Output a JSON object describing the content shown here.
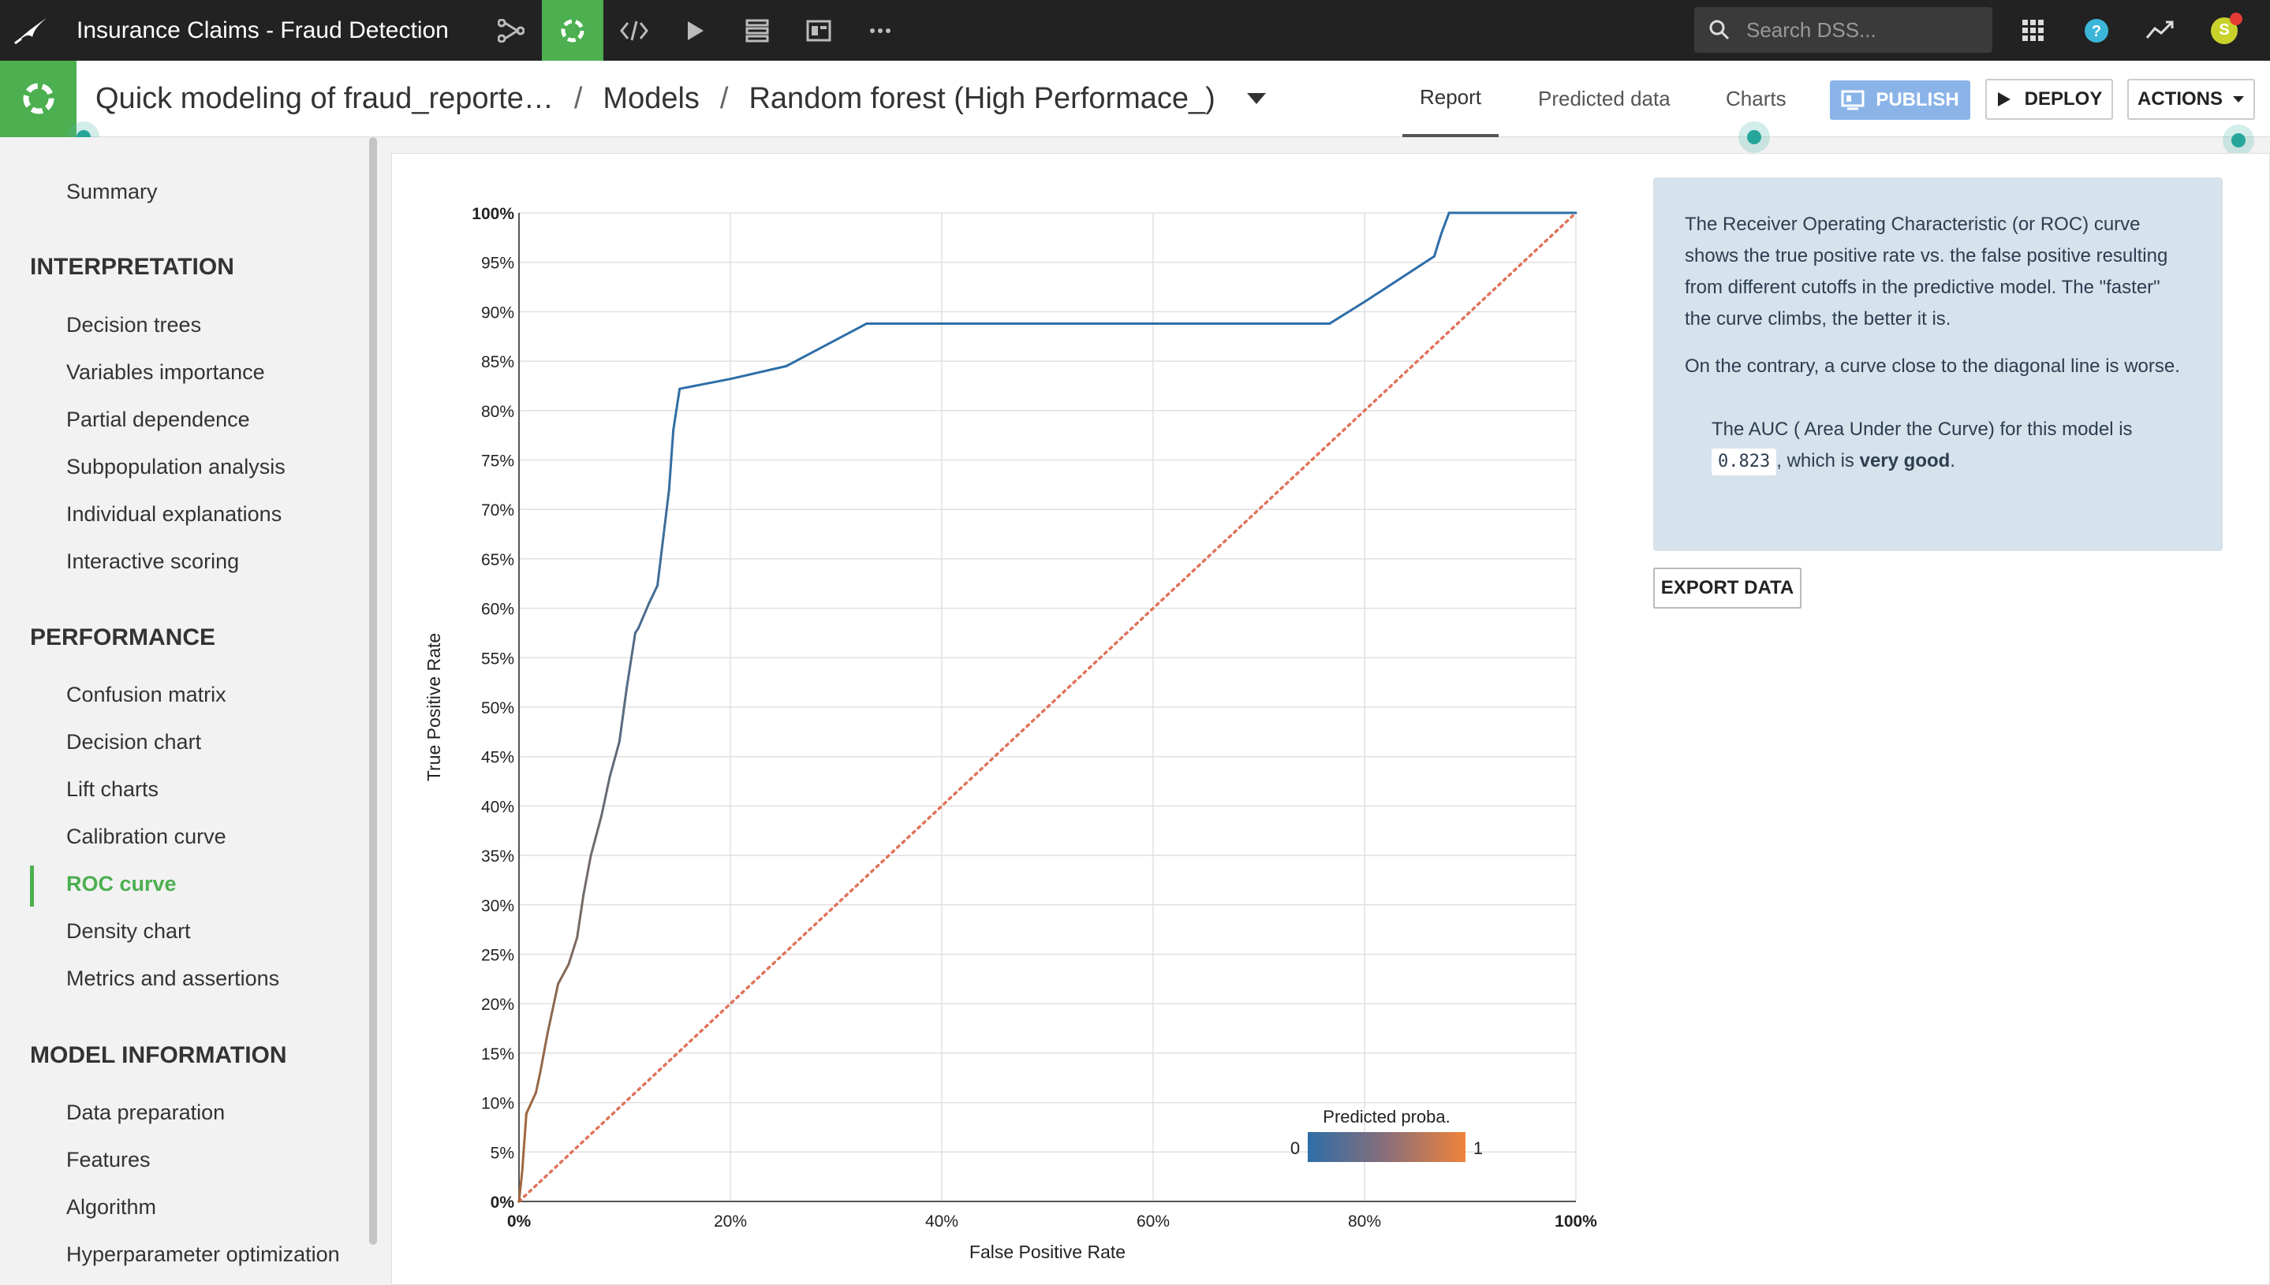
{
  "app": {
    "project_title": "Insurance Claims - Fraud Detection",
    "search_placeholder": "Search DSS...",
    "avatar_initial": "S"
  },
  "header": {
    "breadcrumb": [
      "Quick modeling of fraud_reporte…",
      "Models",
      "Random forest (High Performace_)"
    ],
    "tabs": [
      "Report",
      "Predicted data",
      "Charts"
    ],
    "active_tab": "Report",
    "publish_label": "PUBLISH",
    "deploy_label": "DEPLOY",
    "actions_label": "ACTIONS"
  },
  "sidebar": {
    "summary": "Summary",
    "sections": [
      {
        "title": "INTERPRETATION",
        "items": [
          "Decision trees",
          "Variables importance",
          "Partial dependence",
          "Subpopulation analysis",
          "Individual explanations",
          "Interactive scoring"
        ]
      },
      {
        "title": "PERFORMANCE",
        "items": [
          "Confusion matrix",
          "Decision chart",
          "Lift charts",
          "Calibration curve",
          "ROC curve",
          "Density chart",
          "Metrics and assertions"
        ]
      },
      {
        "title": "MODEL INFORMATION",
        "items": [
          "Data preparation",
          "Features",
          "Algorithm",
          "Hyperparameter optimization"
        ]
      }
    ],
    "active_item": "ROC curve"
  },
  "info": {
    "paragraph1": "The Receiver Operating Characteristic (or ROC) curve shows the true positive rate vs. the false positive resulting from different cutoffs in the predictive model. The \"faster\" the curve climbs, the better it is.",
    "paragraph2": "On the contrary, a curve close to the diagonal line is worse.",
    "auc_prefix": "The AUC ( Area Under the Curve) for this model is",
    "auc_value": "0.823",
    "auc_middle": ", which is",
    "auc_rating": "very good",
    "auc_suffix": ".",
    "export_label": "EXPORT DATA"
  },
  "chart_data": {
    "type": "line",
    "xlabel": "False Positive Rate",
    "ylabel": "True Positive Rate",
    "xlim": [
      0,
      100
    ],
    "ylim": [
      0,
      100
    ],
    "x_ticks": [
      "0%",
      "20%",
      "40%",
      "60%",
      "80%",
      "100%"
    ],
    "y_ticks": [
      "0%",
      "5%",
      "10%",
      "15%",
      "20%",
      "25%",
      "30%",
      "35%",
      "40%",
      "45%",
      "50%",
      "55%",
      "60%",
      "65%",
      "70%",
      "75%",
      "80%",
      "85%",
      "90%",
      "95%",
      "100%"
    ],
    "grid": true,
    "series": [
      {
        "name": "",
        "x": [
          0,
          0.3,
          0.7,
          1.6,
          2.0,
          2.7,
          3.7,
          4.7,
          5.5,
          6.1,
          6.8,
          7.8,
          8.6,
          9.5,
          10.2,
          11.0,
          11.3,
          12.3,
          13.1,
          14.2,
          14.6,
          15.2,
          20.0,
          25.3,
          32.9,
          40.0,
          60.0,
          76.7,
          80.0,
          86.6,
          87.0,
          87.3,
          88.0,
          100
        ],
        "y": [
          0,
          3,
          8.9,
          11,
          13,
          17,
          22,
          24,
          26.7,
          31,
          35,
          39,
          43,
          46.5,
          52,
          57.5,
          58,
          60.5,
          62.3,
          72,
          78,
          82.2,
          83.2,
          84.5,
          88.8,
          88.8,
          88.8,
          88.8,
          91,
          95.6,
          97,
          98,
          100,
          100
        ]
      }
    ],
    "reference_line": {
      "x": [
        0,
        100
      ],
      "y": [
        0,
        100
      ]
    },
    "color_legend": {
      "title": "Predicted proba.",
      "min_label": "0",
      "max_label": "1",
      "colors": [
        "#2e6ea8",
        "#8a6e78",
        "#f0843a"
      ]
    },
    "colors": {
      "curve_low": "#2e6ea8",
      "curve_high": "#a2673d",
      "diagonal": "#e0735a",
      "grid": "#e0e0e0"
    }
  },
  "colors": {
    "accent_green": "#4caf50",
    "topbar": "#222222",
    "publish": "#8ab4e8",
    "info_bg": "#d6e2ec"
  }
}
